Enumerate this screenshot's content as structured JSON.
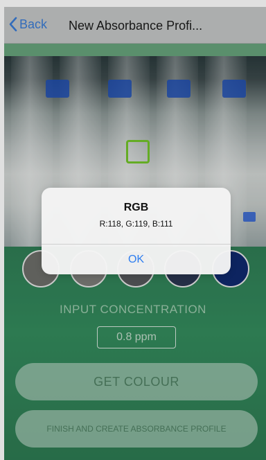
{
  "nav": {
    "back_label": "Back",
    "title": "New Absorbance Profi..."
  },
  "swatches": [
    {
      "color": "#6d6e69"
    },
    {
      "color": "#7b7c78"
    },
    {
      "color": "#55575a"
    },
    {
      "color": "#2b3550"
    },
    {
      "color": "#0f2a6e"
    }
  ],
  "concentration": {
    "label": "INPUT CONCENTRATION",
    "value": "0.8 ppm"
  },
  "buttons": {
    "get_colour": "GET COLOUR",
    "finish": "FINISH AND CREATE ABSORBANCE PROFILE"
  },
  "alert": {
    "title": "RGB",
    "message": "R:118, G:119, B:111",
    "ok_label": "OK"
  },
  "colors": {
    "accent_green": "#348b5d",
    "link_blue": "#3a7bd5",
    "focus_box": "#72c42a"
  }
}
